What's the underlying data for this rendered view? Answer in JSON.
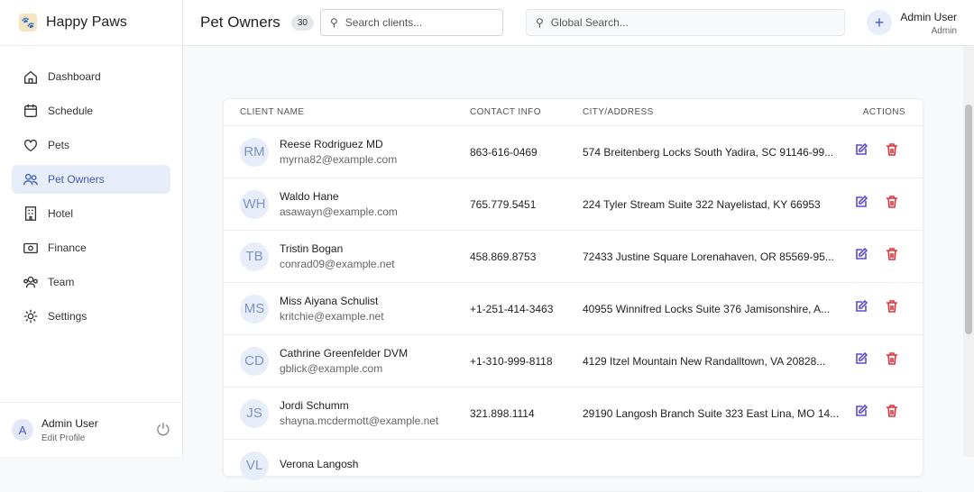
{
  "app": {
    "name": "Happy Paws"
  },
  "sidebar": {
    "items": [
      {
        "label": "Dashboard"
      },
      {
        "label": "Schedule"
      },
      {
        "label": "Pets"
      },
      {
        "label": "Pet Owners"
      },
      {
        "label": "Hotel"
      },
      {
        "label": "Finance"
      },
      {
        "label": "Team"
      },
      {
        "label": "Settings"
      }
    ],
    "user": {
      "initial": "A",
      "name": "Admin User",
      "edit": "Edit Profile"
    }
  },
  "header": {
    "title": "Pet Owners",
    "count": "30",
    "search_placeholder": "Search clients...",
    "global_placeholder": "Global Search...",
    "user_name": "Admin User",
    "user_role": "Admin"
  },
  "table": {
    "headers": [
      "CLIENT NAME",
      "CONTACT INFO",
      "CITY/ADDRESS",
      "ACTIONS"
    ],
    "rows": [
      {
        "initials": "RM",
        "name": "Reese Rodriguez MD",
        "email": "myrna82@example.com",
        "phone": "863-616-0469",
        "address": "574 Breitenberg Locks South Yadira, SC 91146-99..."
      },
      {
        "initials": "WH",
        "name": "Waldo Hane",
        "email": "asawayn@example.com",
        "phone": "765.779.5451",
        "address": "224 Tyler Stream Suite 322 Nayelistad, KY 66953"
      },
      {
        "initials": "TB",
        "name": "Tristin Bogan",
        "email": "conrad09@example.net",
        "phone": "458.869.8753",
        "address": "72433 Justine Square Lorenahaven, OR 85569-95..."
      },
      {
        "initials": "MS",
        "name": "Miss Aiyana Schulist",
        "email": "kritchie@example.net",
        "phone": "+1-251-414-3463",
        "address": "40955 Winnifred Locks Suite 376 Jamisonshire, A..."
      },
      {
        "initials": "CD",
        "name": "Cathrine Greenfelder DVM",
        "email": "gblick@example.com",
        "phone": "+1-310-999-8118",
        "address": "4129 Itzel Mountain New Randalltown, VA 20828..."
      },
      {
        "initials": "JS",
        "name": "Jordi Schumm",
        "email": "shayna.mcdermott@example.net",
        "phone": "321.898.1114",
        "address": "29190 Langosh Branch Suite 323 East Lina, MO 14..."
      },
      {
        "initials": "VL",
        "name": "Verona Langosh",
        "email": "",
        "phone": "",
        "address": ""
      }
    ]
  }
}
